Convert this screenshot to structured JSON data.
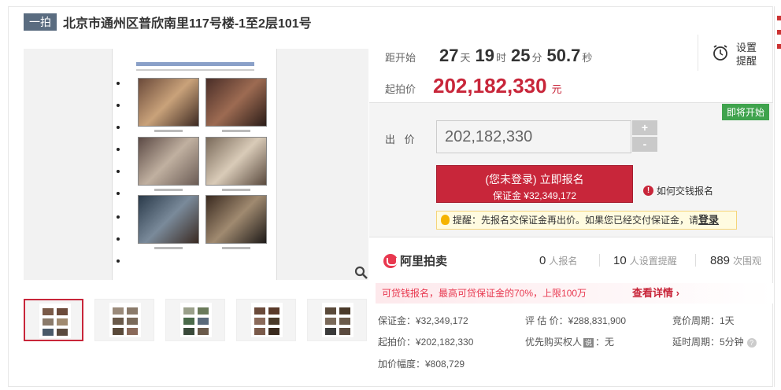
{
  "header": {
    "badge": "一拍",
    "title": "北京市通州区普欣南里117号楼-1至2层101号"
  },
  "countdown": {
    "label": "距开始",
    "days": "27",
    "days_unit": "天",
    "hours": "19",
    "hours_unit": "时",
    "minutes": "25",
    "minutes_unit": "分",
    "seconds": "50.7",
    "seconds_unit": "秒"
  },
  "reminder": {
    "label": "设置提醒",
    "icon": "alarm-clock-icon"
  },
  "start_price": {
    "label": "起拍价",
    "value": "202,182,330",
    "unit": "元"
  },
  "bid": {
    "status_tag": "即将开始",
    "label": "出 价",
    "value": "202,182,330",
    "step_up": "+",
    "step_down": "-",
    "signup_line1": "(您未登录) 立即报名",
    "signup_line2": "保证金 ¥32,349,172",
    "how_to_pay": "如何交钱报名",
    "tip_text": "提醒：先报名交保证金再出价。如果您已经交付保证金，请",
    "tip_link": "登录"
  },
  "stats": {
    "logo_text": "阿里拍卖",
    "signups": "0",
    "signups_label": "人报名",
    "reminders": "10",
    "reminders_label": "人设置提醒",
    "views": "889",
    "views_label": "次围观"
  },
  "promo": {
    "text": "可贷钱报名，最高可贷保证金的70%，上限100万",
    "link": "查看详情 ›"
  },
  "details": {
    "deposit": "保证金：¥32,349,172",
    "appraisal": "评 估 价：¥288,831,900",
    "cycle": "竞价周期：1天",
    "start": "起拍价：¥202,182,330",
    "priority_prefix": "优先购买权人",
    "priority_badge": "说",
    "priority_suffix": "：无",
    "delay": "延时周期：5分钟",
    "increment": "加价幅度：¥808,729"
  },
  "colors": {
    "accent": "#c8263a",
    "badge": "#5a6c80",
    "soon": "#3fa34d"
  }
}
